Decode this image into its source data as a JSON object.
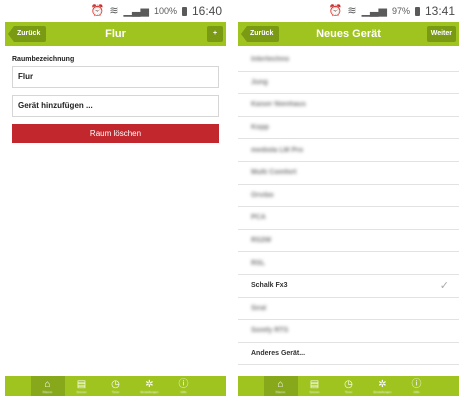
{
  "left": {
    "status": {
      "battery": "100%",
      "time": "16:40"
    },
    "header": {
      "back_label": "Zurück",
      "title": "Flur",
      "add_label": "+"
    },
    "form": {
      "room_label": "Raumbezeichnung",
      "room_value": "Flur",
      "add_device_label": "Gerät hinzufügen ...",
      "delete_label": "Raum löschen"
    }
  },
  "right": {
    "status": {
      "battery": "97%",
      "time": "13:41"
    },
    "header": {
      "back_label": "Zurück",
      "title": "Neues Gerät",
      "next_label": "Weiter"
    },
    "devices": [
      {
        "label": "Intertechno",
        "blurred": true,
        "checked": false
      },
      {
        "label": "Jung",
        "blurred": true,
        "checked": false
      },
      {
        "label": "Kaiser Nienhaus",
        "blurred": true,
        "checked": false
      },
      {
        "label": "Kopp",
        "blurred": true,
        "checked": false
      },
      {
        "label": "mediola LM Pro",
        "blurred": true,
        "checked": false
      },
      {
        "label": "Multi Comfort",
        "blurred": true,
        "checked": false
      },
      {
        "label": "Orvibo",
        "blurred": true,
        "checked": false
      },
      {
        "label": "PCA",
        "blurred": true,
        "checked": false
      },
      {
        "label": "RS2W",
        "blurred": true,
        "checked": false
      },
      {
        "label": "RSL",
        "blurred": true,
        "checked": false
      },
      {
        "label": "Schalk Fx3",
        "blurred": false,
        "checked": true
      },
      {
        "label": "Siral",
        "blurred": true,
        "checked": false
      },
      {
        "label": "Somfy RTS",
        "blurred": true,
        "checked": false
      },
      {
        "label": "Anderes Gerät...",
        "blurred": false,
        "checked": false
      }
    ]
  },
  "tabs": [
    {
      "icon": "rooms-icon",
      "glyph": "⌂",
      "label": "Räume",
      "active": true
    },
    {
      "icon": "scenes-icon",
      "glyph": "▤",
      "label": "Szenen",
      "active": false
    },
    {
      "icon": "clock-icon",
      "glyph": "◷",
      "label": "Timer",
      "active": false
    },
    {
      "icon": "gateway-icon",
      "glyph": "✲",
      "label": "Einstellungen",
      "active": false
    },
    {
      "icon": "info-icon",
      "glyph": "ⓘ",
      "label": "Hilfe",
      "active": false
    }
  ],
  "colors": {
    "accent": "#9fc420",
    "accent_dark": "#7a9a14",
    "danger": "#c1272d"
  }
}
